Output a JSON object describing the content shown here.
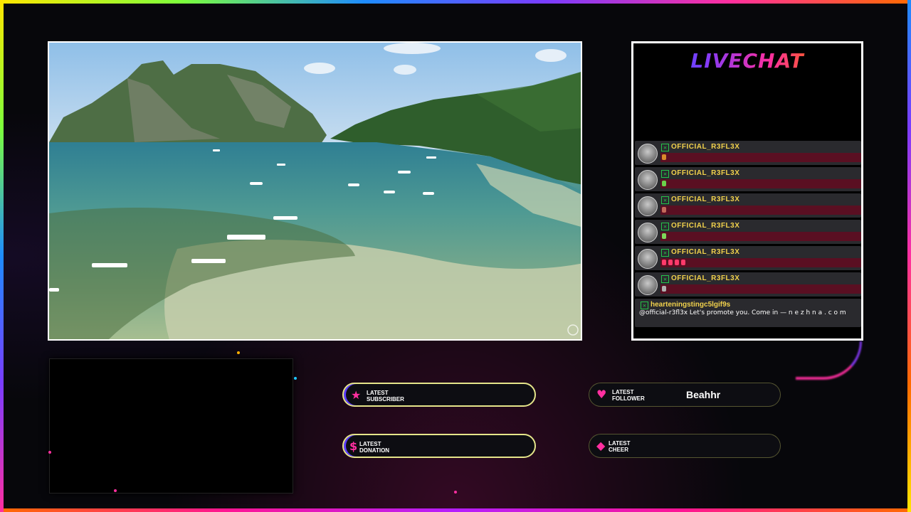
{
  "colors": {
    "accent_yellow": "#f2d24c",
    "chat_body": "#5a0f22",
    "badge_green": "#25c44a",
    "pink": "#ff2fa0"
  },
  "chat": {
    "title": "LIVECHAT",
    "messages": [
      {
        "user": "OFFICIAL_R3FL3X",
        "emote_color": "#d98a2b"
      },
      {
        "user": "OFFICIAL_R3FL3X",
        "emote_color": "#6bd14a"
      },
      {
        "user": "OFFICIAL_R3FL3X",
        "emote_color": "#c46a5a"
      },
      {
        "user": "OFFICIAL_R3FL3X",
        "emote_color": "#7ed85a"
      },
      {
        "user": "OFFICIAL_R3FL3X",
        "emote_color": "#ff3a6a"
      },
      {
        "user": "OFFICIAL_R3FL3X",
        "emote_color": "#b0b0b0"
      }
    ],
    "last_message": {
      "user": "hearteningstingc5lgif9s",
      "text": "@official-r3fl3x Let's promote you. Come in — n e z h n a . c o m"
    }
  },
  "widgets": {
    "subscriber": {
      "label_line1": "LATEST",
      "label_line2": "SUBSCRIBER",
      "value": "",
      "icon": "star-icon"
    },
    "donation": {
      "label_line1": "LATEST",
      "label_line2": "DONATION",
      "value": "",
      "icon": "dollar-icon"
    },
    "follower": {
      "label_line1": "LATEST",
      "label_line2": "FOLLOWER",
      "value": "Beahhr",
      "icon": "heart-icon"
    },
    "cheer": {
      "label_line1": "LATEST",
      "label_line2": "CHEER",
      "value": "",
      "icon": "diamond-icon"
    }
  }
}
